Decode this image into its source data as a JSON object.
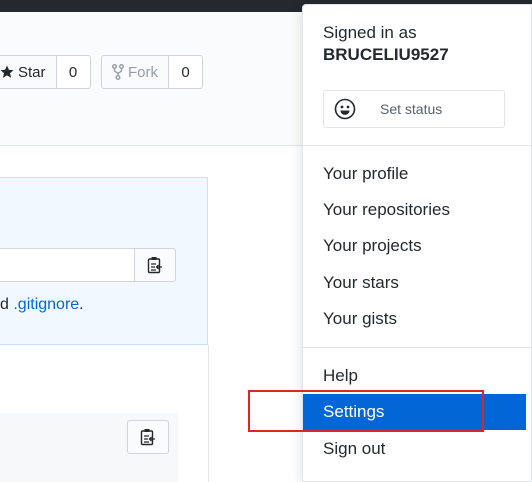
{
  "repo": {
    "star": {
      "label": "Star",
      "count": "0"
    },
    "fork": {
      "label": "Fork",
      "count": "0"
    }
  },
  "quick_setup": {
    "gitignore_prefix": "d ",
    "gitignore_link": ".gitignore",
    "gitignore_suffix": "."
  },
  "menu": {
    "signed_in_as": "Signed in as",
    "username": "BRUCELIU9527",
    "set_status": "Set status",
    "items": [
      {
        "label": "Your profile"
      },
      {
        "label": "Your repositories"
      },
      {
        "label": "Your projects"
      },
      {
        "label": "Your stars"
      },
      {
        "label": "Your gists"
      }
    ],
    "help": "Help",
    "settings": "Settings",
    "sign_out": "Sign out"
  },
  "colors": {
    "accent": "#0366d6",
    "highlight_box": "#e02424"
  },
  "icons": [
    "star-icon",
    "fork-icon",
    "clipboard-icon",
    "smiley-icon"
  ]
}
